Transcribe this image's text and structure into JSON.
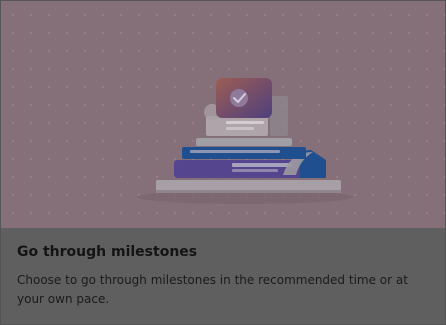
{
  "card": {
    "title": "Go through milestones",
    "description": "Choose to go through milestones in the recommended time or at your own pace."
  },
  "illustration": {
    "icon": "milestone-books-checkmark-illustration",
    "icon_tile_gradient": [
      "#9c5e53",
      "#4f3f7e"
    ],
    "check_badge": "checkmark-icon",
    "colors": {
      "hero_background": "#85707a",
      "book_purple": "#54458e",
      "book_blue": "#1f4f8e",
      "book_light": "#9f9fa5",
      "body_background": "#5f5f5f"
    }
  }
}
